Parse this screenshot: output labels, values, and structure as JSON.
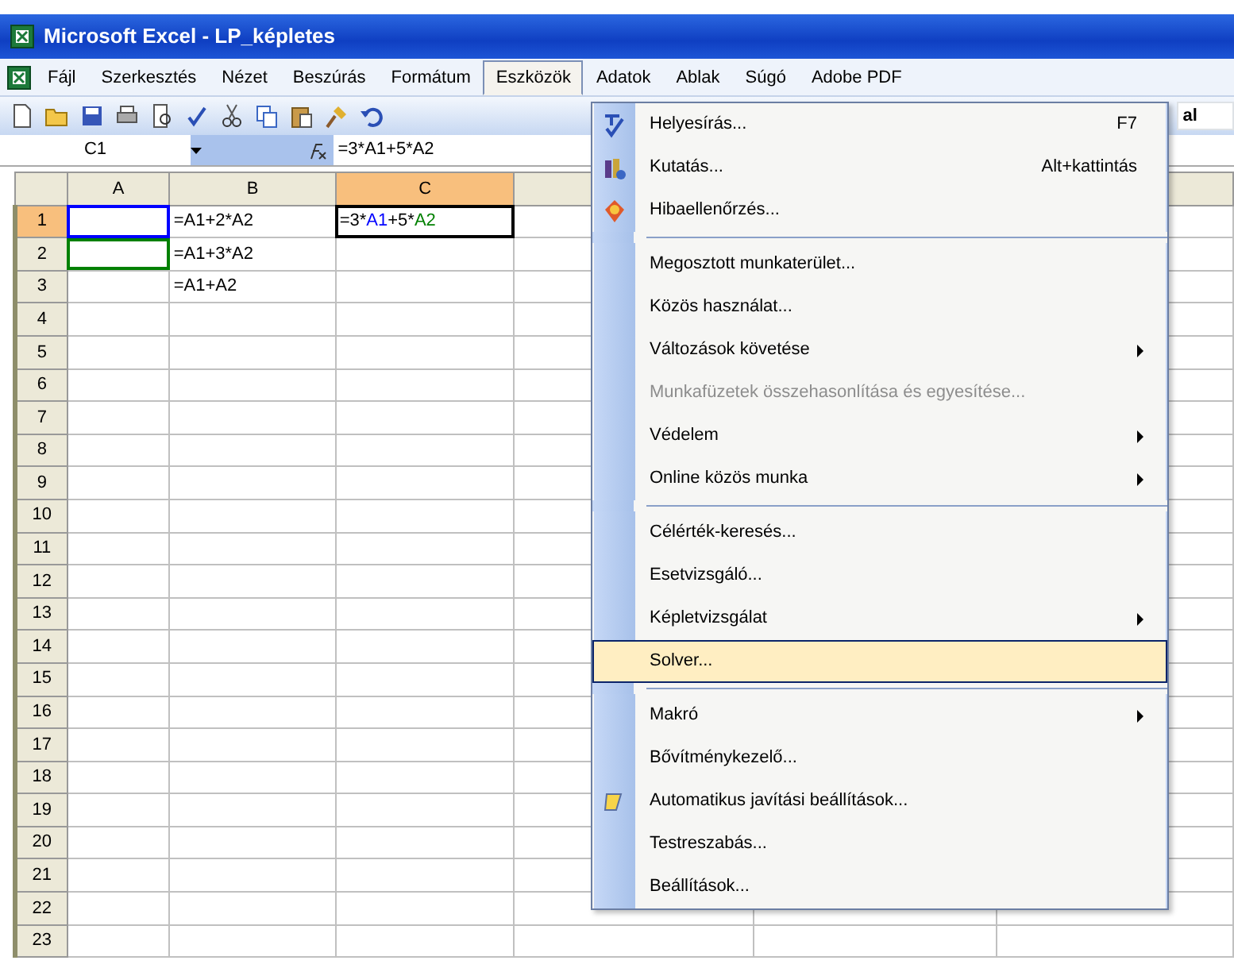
{
  "window": {
    "title": "Microsoft Excel - LP_képletes"
  },
  "menu_bar": [
    {
      "label": "Fájl",
      "selected": false
    },
    {
      "label": "Szerkesztés",
      "selected": false
    },
    {
      "label": "Nézet",
      "selected": false
    },
    {
      "label": "Beszúrás",
      "selected": false
    },
    {
      "label": "Formátum",
      "selected": false
    },
    {
      "label": "Eszközök",
      "selected": true
    },
    {
      "label": "Adatok",
      "selected": false
    },
    {
      "label": "Ablak",
      "selected": false
    },
    {
      "label": "Súgó",
      "selected": false
    },
    {
      "label": "Adobe PDF",
      "selected": false
    }
  ],
  "toolbar": {
    "font_box": "al"
  },
  "formula_bar": {
    "name_box": "C1",
    "formula": "=3*A1+5*A2"
  },
  "sheet": {
    "columns": [
      {
        "label": "A",
        "selected": false
      },
      {
        "label": "B",
        "selected": false
      },
      {
        "label": "C",
        "selected": true
      }
    ],
    "rows": [
      {
        "label": "1",
        "selected": true,
        "cells": [
          {
            "color": "#0000ff"
          },
          {
            "text": "=A1+2*A2"
          },
          {
            "active": true,
            "segments": [
              {
                "text": "=3*"
              },
              {
                "text": "A1",
                "color": "#0000ff"
              },
              {
                "text": "+5*"
              },
              {
                "text": "A2",
                "color": "#008000"
              }
            ]
          }
        ]
      },
      {
        "label": "2",
        "selected": false,
        "cells": [
          {
            "color": "#008000"
          },
          {
            "text": "=A1+3*A2"
          }
        ]
      },
      {
        "label": "3",
        "selected": false,
        "cells": [
          {},
          {
            "text": "=A1+A2"
          }
        ]
      },
      {
        "label": "4",
        "selected": false
      },
      {
        "label": "5",
        "selected": false
      },
      {
        "label": "6",
        "selected": false
      },
      {
        "label": "7",
        "selected": false
      },
      {
        "label": "8",
        "selected": false
      },
      {
        "label": "9",
        "selected": false
      },
      {
        "label": "10",
        "selected": false
      },
      {
        "label": "11",
        "selected": false
      },
      {
        "label": "12",
        "selected": false
      },
      {
        "label": "13",
        "selected": false
      },
      {
        "label": "14",
        "selected": false
      },
      {
        "label": "15",
        "selected": false
      },
      {
        "label": "16",
        "selected": false
      },
      {
        "label": "17",
        "selected": false
      },
      {
        "label": "18",
        "selected": false
      },
      {
        "label": "19",
        "selected": false
      },
      {
        "label": "20",
        "selected": false
      },
      {
        "label": "21",
        "selected": false
      },
      {
        "label": "22",
        "selected": false
      },
      {
        "label": "23",
        "selected": false
      }
    ]
  },
  "tools_menu": [
    {
      "kind": "item",
      "label": "Helyesírás...",
      "shortcut": "F7",
      "submenu": false,
      "disabled": false,
      "selected": false
    },
    {
      "kind": "item",
      "label": "Kutatás...",
      "shortcut": "Alt+kattintás",
      "submenu": false,
      "disabled": false,
      "selected": false
    },
    {
      "kind": "item",
      "label": "Hibaellenőrzés...",
      "submenu": false,
      "disabled": false,
      "selected": false
    },
    {
      "kind": "separator"
    },
    {
      "kind": "item",
      "label": "Megosztott munkaterület...",
      "submenu": false,
      "disabled": false,
      "selected": false
    },
    {
      "kind": "item",
      "label": "Közös használat...",
      "submenu": false,
      "disabled": false,
      "selected": false
    },
    {
      "kind": "item",
      "label": "Változások követése",
      "submenu": true,
      "disabled": false,
      "selected": false
    },
    {
      "kind": "item",
      "label": "Munkafüzetek összehasonlítása és egyesítése...",
      "submenu": false,
      "disabled": true,
      "selected": false
    },
    {
      "kind": "item",
      "label": "Védelem",
      "submenu": true,
      "disabled": false,
      "selected": false
    },
    {
      "kind": "item",
      "label": "Online közös munka",
      "submenu": true,
      "disabled": false,
      "selected": false
    },
    {
      "kind": "separator"
    },
    {
      "kind": "item",
      "label": "Célérték-keresés...",
      "submenu": false,
      "disabled": false,
      "selected": false
    },
    {
      "kind": "item",
      "label": "Esetvizsgáló...",
      "submenu": false,
      "disabled": false,
      "selected": false
    },
    {
      "kind": "item",
      "label": "Képletvizsgálat",
      "submenu": true,
      "disabled": false,
      "selected": false
    },
    {
      "kind": "item",
      "label": "Solver...",
      "submenu": false,
      "disabled": false,
      "selected": true
    },
    {
      "kind": "separator"
    },
    {
      "kind": "item",
      "label": "Makró",
      "submenu": true,
      "disabled": false,
      "selected": false
    },
    {
      "kind": "item",
      "label": "Bővítménykezelő...",
      "submenu": false,
      "disabled": false,
      "selected": false
    },
    {
      "kind": "item",
      "label": "Automatikus javítási beállítások...",
      "submenu": false,
      "disabled": false,
      "selected": false
    },
    {
      "kind": "item",
      "label": "Testreszabás...",
      "submenu": false,
      "disabled": false,
      "selected": false
    },
    {
      "kind": "item",
      "label": "Beállítások...",
      "submenu": false,
      "disabled": false,
      "selected": false
    }
  ]
}
